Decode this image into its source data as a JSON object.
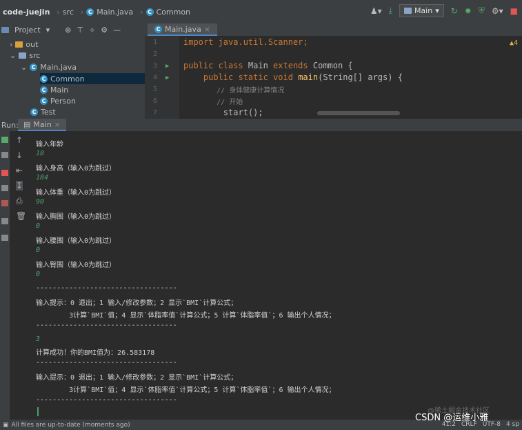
{
  "nav": {
    "project": "code-juejin",
    "crumbs": [
      "src",
      "Main.java",
      "Common"
    ],
    "run_config": "Main",
    "icons": [
      "user-icon",
      "hammer-icon",
      "run-icon",
      "debug-icon",
      "coverage-icon",
      "profile-icon",
      "stop-icon"
    ]
  },
  "project_panel": {
    "title": "Project",
    "tree": [
      {
        "label": "out",
        "type": "folder"
      },
      {
        "label": "src",
        "type": "folder"
      },
      {
        "label": "Main.java",
        "type": "file"
      },
      {
        "label": "Common",
        "type": "class"
      },
      {
        "label": "Main",
        "type": "class"
      },
      {
        "label": "Person",
        "type": "class"
      },
      {
        "label": "Test",
        "type": "class"
      }
    ]
  },
  "editor": {
    "tab": "Main.java",
    "lines": [
      {
        "n": "1",
        "text": "import java.util.Scanner;"
      },
      {
        "n": "2",
        "text": ""
      },
      {
        "n": "3",
        "text": "public class Main extends Common {"
      },
      {
        "n": "4",
        "text": "    public static void main(String[] args) {"
      },
      {
        "n": "5",
        "text": "        // 身体健康计算情况"
      },
      {
        "n": "6",
        "text": "        // 开始"
      },
      {
        "n": "7",
        "text": "        start();"
      }
    ],
    "warning": "4"
  },
  "run": {
    "label": "Run:",
    "tab": "Main",
    "console": [
      {
        "text": "输入年龄",
        "kind": "out"
      },
      {
        "text": "18",
        "kind": "in"
      },
      {
        "text": "输入身高（输入0为跳过）",
        "kind": "out"
      },
      {
        "text": "184",
        "kind": "in"
      },
      {
        "text": "输入体重（输入0为跳过）",
        "kind": "out"
      },
      {
        "text": "90",
        "kind": "in"
      },
      {
        "text": "输入胸围（输入0为跳过）",
        "kind": "out"
      },
      {
        "text": "0",
        "kind": "in"
      },
      {
        "text": "输入腰围（输入0为跳过）",
        "kind": "out"
      },
      {
        "text": "0",
        "kind": "in"
      },
      {
        "text": "输入臀围（输入0为跳过）",
        "kind": "out"
      },
      {
        "text": "0",
        "kind": "in"
      },
      {
        "text": "----------------------------------",
        "kind": "out"
      },
      {
        "text": "输入提示：0 退出；1 输入/修改参数；2 显示`BMI`计算公式；",
        "kind": "out"
      },
      {
        "text": "        3计算`BMI`值；4 显示`体脂率值`计算公式；5 计算`体脂率值`；6 输出个人情况；",
        "kind": "out"
      },
      {
        "text": "----------------------------------",
        "kind": "out"
      },
      {
        "text": "3",
        "kind": "in"
      },
      {
        "text": "计算成功！你的BMI值为：26.583178",
        "kind": "out"
      },
      {
        "text": "----------------------------------",
        "kind": "out"
      },
      {
        "text": "输入提示：0 退出；1 输入/修改参数；2 显示`BMI`计算公式；",
        "kind": "out"
      },
      {
        "text": "        3计算`BMI`值；4 显示`体脂率值`计算公式；5 计算`体脂率值`；6 输出个人情况；",
        "kind": "out"
      },
      {
        "text": "----------------------------------",
        "kind": "out"
      },
      {
        "text": "",
        "kind": "in"
      }
    ]
  },
  "status": {
    "message": "All files are up-to-date (moments ago)",
    "position": "41:2",
    "line_sep": "CRLF",
    "encoding": "UTF-8",
    "indent": "4 sp"
  },
  "watermark": {
    "text": "CSDN @运维小雅",
    "faint": "@稀土掘金技术社区"
  }
}
